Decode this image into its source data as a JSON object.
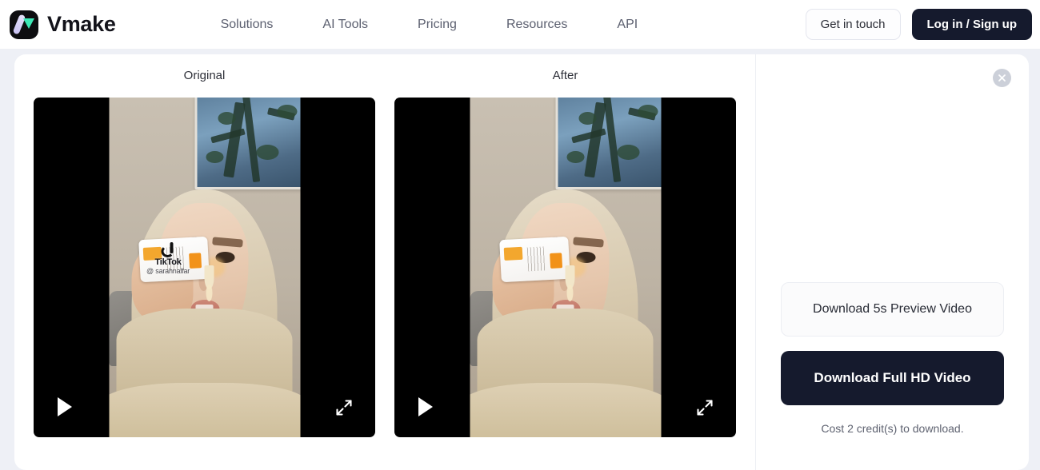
{
  "header": {
    "brand_name": "Vmake",
    "logo_icon": "vmake-logo-icon",
    "nav": [
      {
        "label": "Solutions"
      },
      {
        "label": "AI Tools"
      },
      {
        "label": "Pricing"
      },
      {
        "label": "Resources"
      },
      {
        "label": "API"
      }
    ],
    "get_in_touch_label": "Get in touch",
    "login_signup_label": "Log in / Sign up"
  },
  "compare": {
    "original_label": "Original",
    "after_label": "After",
    "play_icon": "play-icon",
    "expand_icon": "expand-icon",
    "watermark": {
      "brand": "TikTok",
      "handle": "@ sarahnalfar",
      "note_icon": "music-note-icon"
    }
  },
  "panel": {
    "close_icon": "close-icon",
    "preview_button_label": "Download 5s Preview Video",
    "full_hd_button_label": "Download Full HD Video",
    "cost_note": "Cost 2 credit(s) to download."
  },
  "colors": {
    "page_background": "#eef0f6",
    "card_background": "#ffffff",
    "dark_button": "#151a2d",
    "accent_teal": "#3ce8b6",
    "accent_lilac": "#c9c2f2",
    "muted_text": "#5c6070"
  }
}
